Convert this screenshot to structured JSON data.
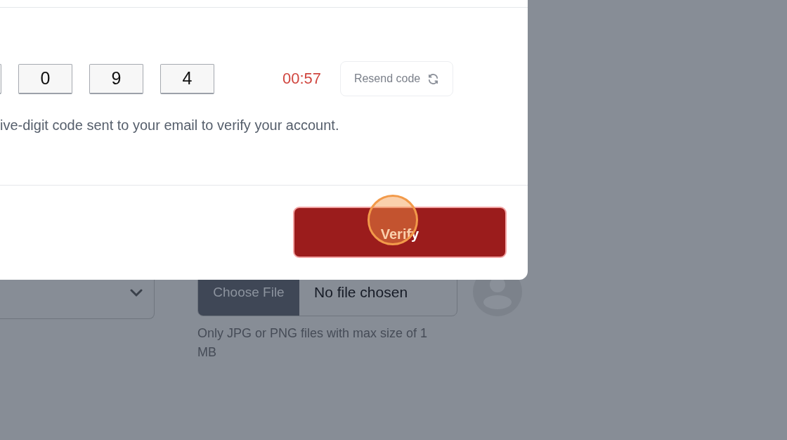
{
  "verify_dialog": {
    "code_digits": [
      "0",
      "9",
      "4"
    ],
    "timer": "00:57",
    "resend_button": "Resend code",
    "message": "ive-digit code sent to your email to verify your account.",
    "verify_button": "Verify"
  },
  "form": {
    "file_input": {
      "button": "Choose File",
      "value": "No file chosen"
    },
    "file_hint": "Only JPG or PNG files with max size of 1 MB"
  }
}
